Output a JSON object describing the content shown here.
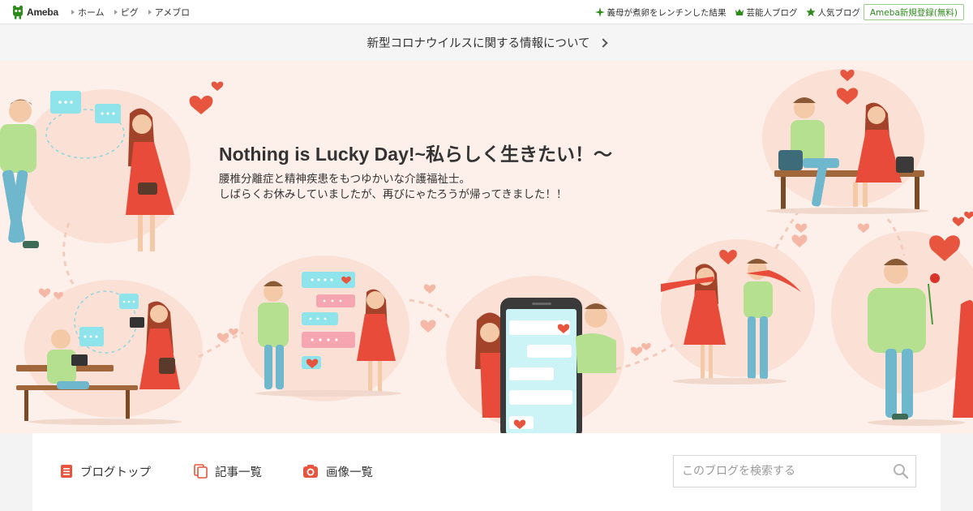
{
  "brand": {
    "logo_text": "Ameba"
  },
  "topnav": [
    {
      "label": "ホーム"
    },
    {
      "label": "ピグ"
    },
    {
      "label": "アメブロ"
    }
  ],
  "rightnav": [
    {
      "label": "義母が煮卵をレンチンした結果",
      "icon": "sparkle-icon"
    },
    {
      "label": "芸能人ブログ",
      "icon": "crown-icon"
    },
    {
      "label": "人気ブログ",
      "icon": "star-icon"
    }
  ],
  "signup_label": "Ameba新規登録(無料)",
  "notice": {
    "text": "新型コロナウイルスに関する情報について"
  },
  "blog": {
    "title": "Nothing is Lucky Day!~私らしく生きたい！〜",
    "description_line1": "腰椎分離症と精神疾患をもつゆかいな介護福祉士。",
    "description_line2": "しばらくお休みしていましたが、再びにゃたろうが帰ってきました！！"
  },
  "blognav": [
    {
      "label": "ブログトップ",
      "icon": "document-icon"
    },
    {
      "label": "記事一覧",
      "icon": "copy-icon"
    },
    {
      "label": "画像一覧",
      "icon": "camera-icon"
    }
  ],
  "search": {
    "placeholder": "このブログを検索する"
  },
  "colors": {
    "accent_red": "#e8553e",
    "brand_green": "#2f8a1c",
    "header_bg": "#fdf0ea",
    "blob_pink": "#fbe0d6"
  }
}
